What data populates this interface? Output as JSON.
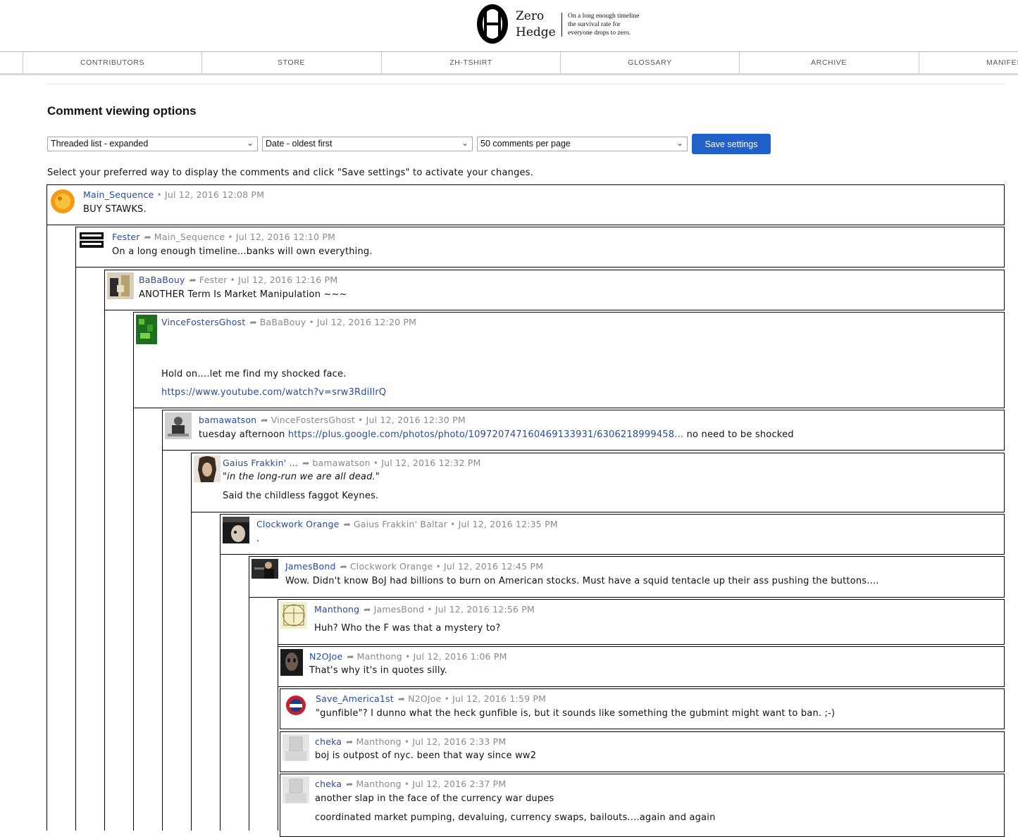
{
  "header": {
    "logo_line1": "Zero",
    "logo_line2": "Hedge",
    "tagline_line1": "On a long enough timeline",
    "tagline_line2": "the survival rate for",
    "tagline_line3": "everyone drops to zero."
  },
  "nav": {
    "items": [
      {
        "label": "CONTRIBUTORS"
      },
      {
        "label": "STORE"
      },
      {
        "label": "ZH-TSHIRT"
      },
      {
        "label": "GLOSSARY"
      },
      {
        "label": "ARCHIVE"
      },
      {
        "label": "MANIFES"
      }
    ]
  },
  "options": {
    "title": "Comment viewing options",
    "display_mode": "Threaded list - expanded",
    "sort_order": "Date - oldest first",
    "per_page": "50 comments per page",
    "save_label": "Save settings",
    "hint": "Select your preferred way to display the comments and click \"Save settings\" to activate your changes."
  },
  "colors": {
    "accent": "#2160c8",
    "link": "#2a4b9b",
    "meta": "#8a8a8a"
  },
  "comments": [
    {
      "author": "Main_Sequence",
      "reply_to": "",
      "date": "Jul 12, 2016 12:08 PM",
      "lines": [
        "BUY STAWKS."
      ]
    },
    {
      "author": "Fester",
      "reply_to": "Main_Sequence",
      "date": "Jul 12, 2016 12:10 PM",
      "lines": [
        "On a long enough timeline...banks will own everything."
      ]
    },
    {
      "author": "BaBaBouy",
      "reply_to": "Fester",
      "date": "Jul 12, 2016 12:16 PM",
      "lines": [
        "ANOTHER Term Is Market Manipulation ~~~"
      ]
    },
    {
      "author": "VinceFostersGhost",
      "reply_to": "BaBaBouy",
      "date": "Jul 12, 2016 12:20 PM",
      "lines": [
        "Hold on....let me find my shocked face.",
        "https://www.youtube.com/watch?v=srw3RdiIlrQ"
      ]
    },
    {
      "author": "bamawatson",
      "reply_to": "VinceFostersGhost",
      "date": "Jul 12, 2016 12:30 PM",
      "lines": [
        "tuesday afternoon",
        "https://plus.google.com/photos/photo/109720747160469133931/6306218999458...",
        "no need to be shocked"
      ]
    },
    {
      "author": "Gaius Frakkin' ...",
      "reply_to": "bamawatson",
      "date": "Jul 12, 2016 12:32 PM",
      "lines": [
        "\"in the long-run we are all dead.\"",
        "Said the childless faggot Keynes."
      ]
    },
    {
      "author": "Clockwork Orange",
      "reply_to": "Gaius Frakkin' Baltar",
      "date": "Jul 12, 2016 12:35 PM",
      "lines": [
        "."
      ]
    },
    {
      "author": "JamesBond",
      "reply_to": "Clockwork Orange",
      "date": "Jul 12, 2016 12:45 PM",
      "lines": [
        "Wow.  Didn't know BoJ had billions to burn on American stocks.  Must have a squid tentacle up their ass pushing the buttons...."
      ]
    },
    {
      "author": "Manthong",
      "reply_to": "JamesBond",
      "date": "Jul 12, 2016 12:56 PM",
      "lines": [
        "Huh? Who the F was that a mystery to?"
      ]
    },
    {
      "author": "N2OJoe",
      "reply_to": "Manthong",
      "date": "Jul 12, 2016 1:06 PM",
      "lines": [
        "That's why it's in quotes silly."
      ]
    },
    {
      "author": "Save_America1st",
      "reply_to": "N2OJoe",
      "date": "Jul 12, 2016 1:59 PM",
      "lines": [
        "\"gunfible\"?  I dunno what the heck gunfible is, but it sounds like something the gubmint might want to ban. ;-)"
      ]
    },
    {
      "author": "cheka",
      "reply_to": "Manthong",
      "date": "Jul 12, 2016 2:33 PM",
      "lines": [
        "boj is outpost of nyc.  been that way since ww2"
      ]
    },
    {
      "author": "cheka",
      "reply_to": "Manthong",
      "date": "Jul 12, 2016 2:37 PM",
      "lines": [
        "another slap in the face of the currency war dupes",
        "coordinated market pumping, devaluing, currency swaps, bailouts....again and again"
      ]
    }
  ]
}
